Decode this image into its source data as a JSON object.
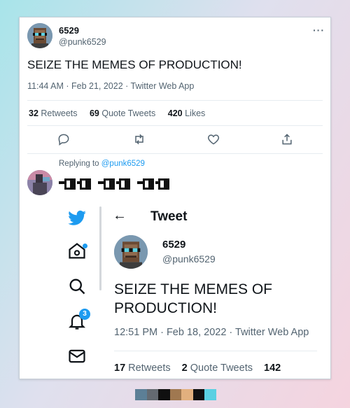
{
  "tweet": {
    "name": "6529",
    "handle": "@punk6529",
    "more_label": "···",
    "text": "SEIZE THE MEMES OF PRODUCTION!",
    "meta": "11:44 AM · Feb 21, 2022 · Twitter Web App",
    "stats": {
      "retweets_count": "32",
      "retweets_label": "Retweets",
      "quotes_count": "69",
      "quotes_label": "Quote Tweets",
      "likes_count": "420",
      "likes_label": "Likes"
    },
    "actions": [
      "reply-icon",
      "retweet-icon",
      "like-icon",
      "share-icon"
    ]
  },
  "reply": {
    "prefix": "Replying to",
    "mention": "@punk6529"
  },
  "inner_tweet": {
    "header_title": "Tweet",
    "back": "←",
    "name": "6529",
    "handle": "@punk6529",
    "text": "SEIZE THE MEMES OF PRODUCTION!",
    "meta": "12:51 PM · Feb 18, 2022 · Twitter Web App",
    "stats": {
      "retweets_count": "17",
      "retweets_label": "Retweets",
      "quotes_count": "2",
      "quotes_label": "Quote Tweets",
      "likes_count": "142"
    },
    "nav": [
      "twitter-bird-icon",
      "home-icon",
      "search-icon",
      "notifications-icon",
      "messages-icon"
    ],
    "notifications_badge": "3"
  },
  "colors": {
    "accent": "#1d9bf0",
    "palette": [
      "#5c7f96",
      "#646a71",
      "#101010",
      "#a07850",
      "#e2b07e",
      "#101010",
      "#5ad0e2"
    ]
  }
}
